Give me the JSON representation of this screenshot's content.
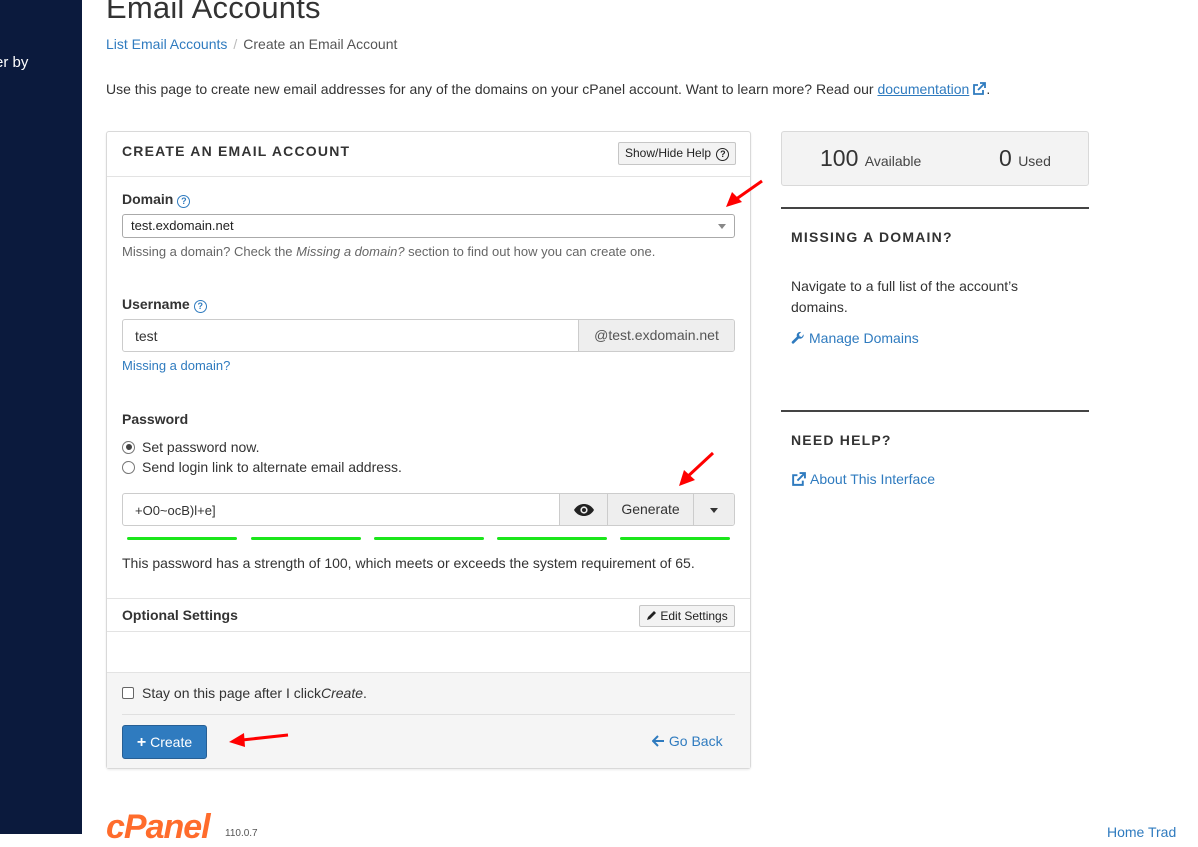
{
  "sidebar": {
    "partial_text": "er by"
  },
  "page": {
    "title": "Email Accounts",
    "breadcrumb": {
      "link": "List Email Accounts",
      "separator": "/",
      "current": "Create an Email Account"
    },
    "intro_text": "Use this page to create new email addresses for any of the domains on your cPanel account. Want to learn more? Read our",
    "intro_link": "documentation",
    "intro_end": "."
  },
  "form": {
    "title": "CREATE AN EMAIL ACCOUNT",
    "help_button": "Show/Hide Help",
    "domain_label": "Domain",
    "domain_value": "test.exdomain.net",
    "domain_help_pre": "Missing a domain? Check the ",
    "domain_help_em": "Missing a domain?",
    "domain_help_post": " section to find out how you can create one.",
    "username_label": "Username",
    "username_value": "test",
    "username_suffix": "@test.exdomain.net",
    "missing_domain_link": "Missing a domain?",
    "password_label": "Password",
    "radio_set_now": "Set password now.",
    "radio_send_link": "Send login link to alternate email address.",
    "password_value": "+O0~ocB)l+e]",
    "generate_label": "Generate",
    "strength_text": "This password has a strength of 100, which meets or exceeds the system requirement of 65.",
    "strength_value": 100,
    "optional_title": "Optional Settings",
    "edit_settings": "Edit Settings",
    "stay_pre": "Stay on this page after I click ",
    "stay_em": "Create",
    "stay_post": ".",
    "create_label": "Create",
    "go_back_label": "Go Back"
  },
  "stats": {
    "available": "100",
    "available_label": "Available",
    "used": "0",
    "used_label": "Used"
  },
  "missing_domain": {
    "heading": "MISSING A DOMAIN?",
    "text": "Navigate to a full list of the account’s domains.",
    "link": "Manage Domains"
  },
  "need_help": {
    "heading": "NEED HELP?",
    "link": "About This Interface"
  },
  "footer": {
    "logo": "cPanel",
    "version": "110.0.7",
    "links": "Home   Trad"
  },
  "colors": {
    "sidebar": "#0b1a3d",
    "accent": "#2f7bbf",
    "meter": "#1be61b",
    "annotation_arrow": "#ff0000",
    "logo": "#ff6c2c"
  }
}
